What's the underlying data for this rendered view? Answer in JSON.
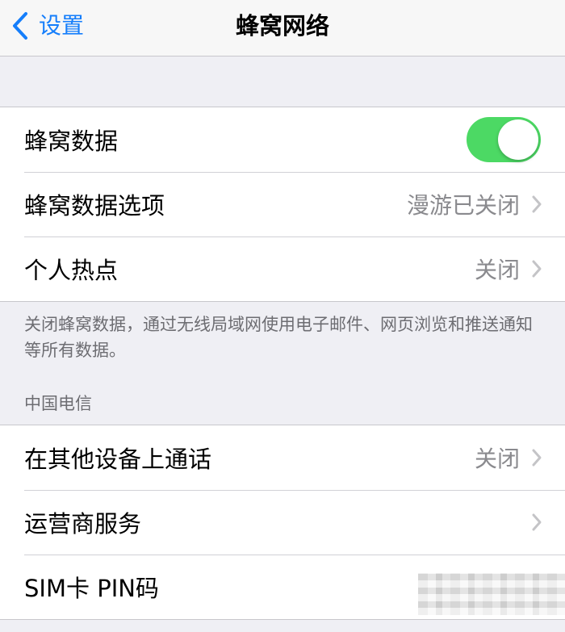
{
  "navbar": {
    "back_label": "设置",
    "title": "蜂窝网络"
  },
  "group1": {
    "rows": [
      {
        "label": "蜂窝数据",
        "toggle_on": true
      },
      {
        "label": "蜂窝数据选项",
        "value": "漫游已关闭"
      },
      {
        "label": "个人热点",
        "value": "关闭"
      }
    ],
    "footnote": "关闭蜂窝数据，通过无线局域网使用电子邮件、网页浏览和推送通知等所有数据。"
  },
  "group2": {
    "header": "中国电信",
    "rows": [
      {
        "label": "在其他设备上通话",
        "value": "关闭"
      },
      {
        "label": "运营商服务"
      },
      {
        "label": "SIM卡 PIN码"
      }
    ]
  },
  "colors": {
    "accent": "#157efb",
    "toggle_on": "#4cd964",
    "background": "#efeff4",
    "secondary_text": "#8a8a8e"
  },
  "icons": {
    "back": "chevron-left-icon",
    "disclosure": "chevron-right-icon"
  }
}
